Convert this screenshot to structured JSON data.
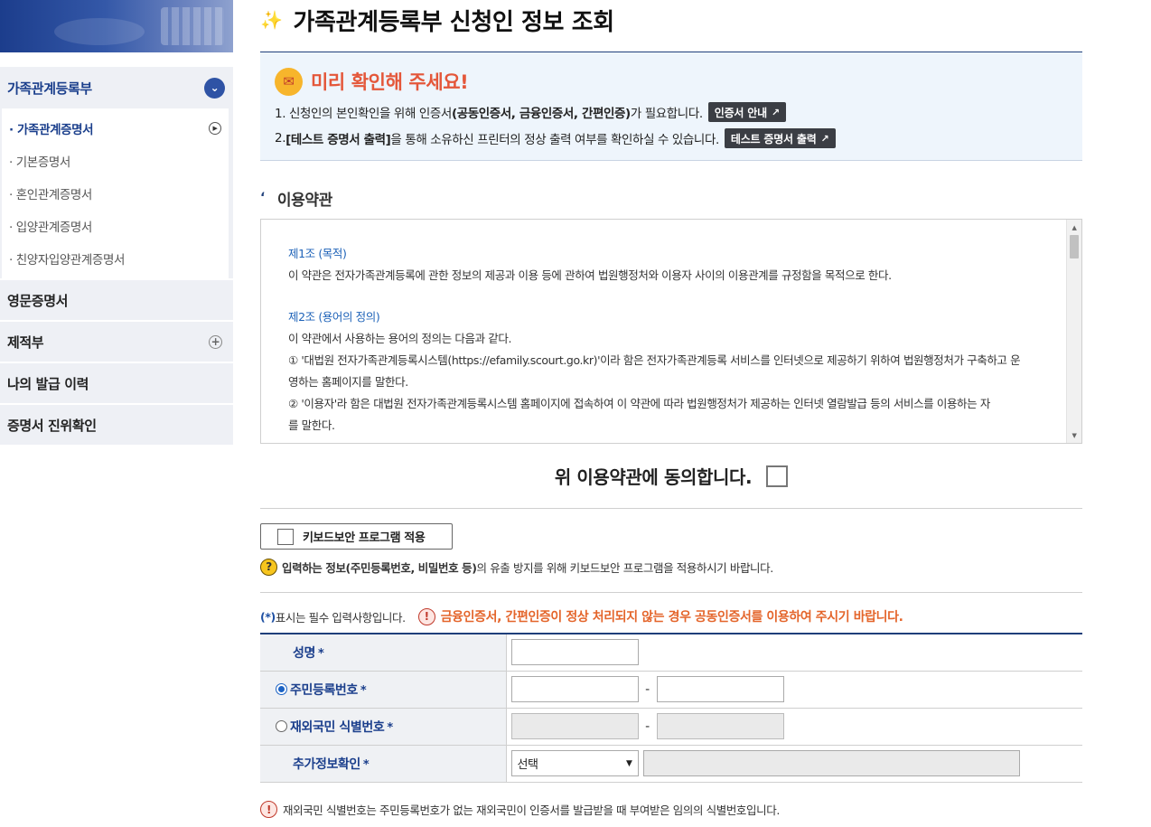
{
  "sidebar": {
    "group_title": "가족관계등록부",
    "sub_items": [
      {
        "label": "· 가족관계증명서",
        "active": true
      },
      {
        "label": "· 기본증명서",
        "active": false
      },
      {
        "label": "· 혼인관계증명서",
        "active": false
      },
      {
        "label": "· 입양관계증명서",
        "active": false
      },
      {
        "label": "· 친양자입양관계증명서",
        "active": false
      }
    ],
    "items": [
      {
        "label": "영문증명서"
      },
      {
        "label": "제적부"
      },
      {
        "label": "나의 발급 이력"
      },
      {
        "label": "증명서 진위확인"
      }
    ]
  },
  "main": {
    "page_title": "가족관계등록부 신청인 정보 조회",
    "notice": {
      "heading": "미리 확인해 주세요!",
      "line1_a": "1. 신청인의 본인확인을 위해 인증서",
      "line1_b": "(공동인증서, 금융인증서, 간편인증)",
      "line1_c": "가 필요합니다.",
      "line1_button": "인증서 안내",
      "line2_a": "2. ",
      "line2_b": "[테스트 증명서 출력]",
      "line2_c": "을 통해 소유하신 프린터의 정상 출력 여부를 확인하실 수 있습니다.",
      "line2_button": "테스트 증명서 출력"
    },
    "terms": {
      "section_title": "이용약관",
      "art1_title": "제1조 (목적)",
      "art1_body": "이 약관은 전자가족관계등록에 관한 정보의 제공과 이용 등에 관하여 법원행정처와 이용자 사이의 이용관계를 규정함을 목적으로 한다.",
      "art2_title": "제2조 (용어의 정의)",
      "art2_body": "이 약관에서 사용하는 용어의 정의는 다음과 같다.",
      "art2_item1a": "① '대법원 전자가족관계등록시스템(https://efamily.scourt.go.kr)'이라 함은 전자가족관계등록 서비스를 인터넷으로 제공하기 위하여 법원행정처가 구축하고 운",
      "art2_item1b": "영하는 홈페이지를 말한다.",
      "art2_item2a": "② '이용자'라 함은 대법원 전자가족관계등록시스템 홈페이지에 접속하여 이 약관에 따라 법원행정처가 제공하는 인터넷 열람발급 등의 서비스를 이용하는 자",
      "art2_item2b": "를 말한다."
    },
    "agree_label": "위 이용약관에 동의합니다.",
    "keyboard_button": "키보드보안 프로그램 적용",
    "keyboard_note_a": "입력하는 정보(주민등록번호, 비밀번호 등)",
    "keyboard_note_b": "의 유출 방지를 위해 키보드보안 프로그램을 적용하시기 바랍니다.",
    "required_note_star": "(*)",
    "required_note": " 표시는 필수 입력사항입니다.",
    "warning_text": "금융인증서, 간편인증이 정상 처리되지 않는 경우 공동인증서를 이용하여 주시기 바랍니다.",
    "form": {
      "name_label": "성명",
      "rrn_label": "주민등록번호",
      "foreign_label": "재외국민 식별번호",
      "extra_label": "추가정보확인",
      "required_mark": "*",
      "dash": "-",
      "select_value": "선택"
    },
    "footer_note": "재외국민 식별번호는 주민등록번호가 없는 재외국민이 인증서를 발급받을 때 부여받은 임의의 식별번호입니다."
  },
  "colors": {
    "brand": "#1f3f7a",
    "accent": "#2f53a5",
    "warning": "#e4652b",
    "link": "#1d62b8"
  }
}
